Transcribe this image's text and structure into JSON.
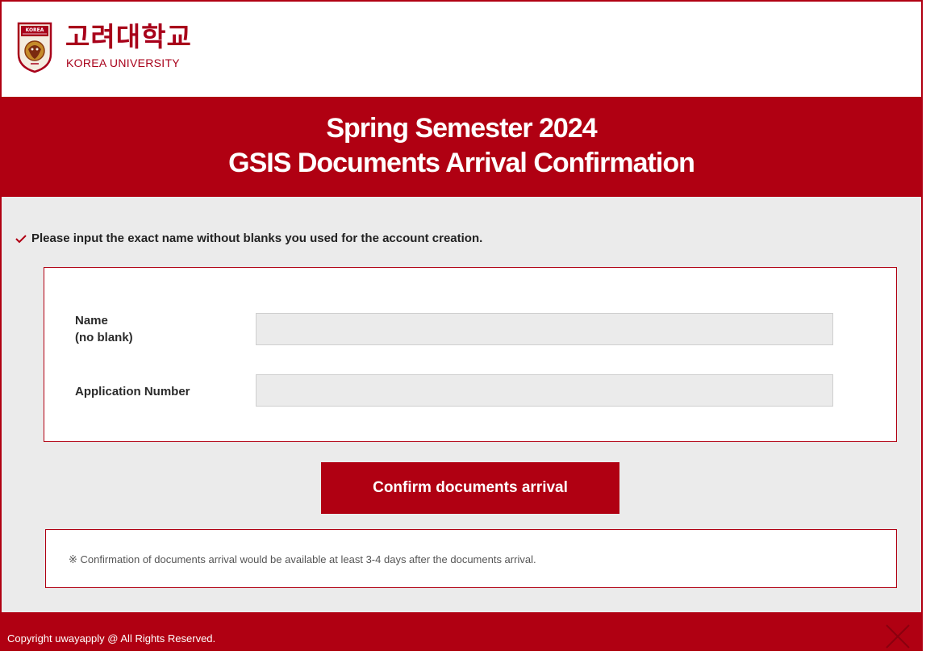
{
  "logo": {
    "korean": "고려대학교",
    "english": "KOREA UNIVERSITY",
    "crest_text": "KOREA"
  },
  "title": {
    "line1": "Spring Semester 2024",
    "line2": "GSIS Documents Arrival Confirmation"
  },
  "notice": "Please input the exact name without blanks you used for the account creation.",
  "form": {
    "name_label_line1": "Name",
    "name_label_line2": "(no blank)",
    "name_value": "",
    "app_number_label": "Application Number",
    "app_number_value": ""
  },
  "confirm_button": "Confirm documents arrival",
  "note": "※ Confirmation of documents arrival would be available at least 3-4 days after the documents arrival.",
  "footer": {
    "copyright": "Copyright uwayapply @ All Rights Reserved."
  },
  "colors": {
    "brand_red": "#b00012",
    "background": "#ebebeb"
  },
  "icons": [
    "crest-logo-icon",
    "check-icon",
    "close-icon"
  ]
}
